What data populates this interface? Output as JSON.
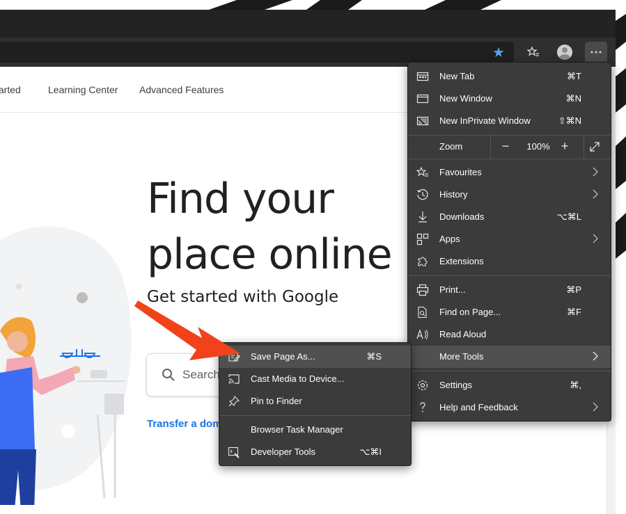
{
  "nav": {
    "links": [
      "tarted",
      "Learning Center",
      "Advanced Features"
    ]
  },
  "hero": {
    "title_line1": "Find your",
    "title_line2": "place online",
    "subtitle": "Get started with Google"
  },
  "search": {
    "placeholder": "Search"
  },
  "transfer_link": "Transfer a dom",
  "toolbar": {
    "icons": [
      "star-icon",
      "favorites-icon",
      "profile-avatar",
      "more-icon"
    ],
    "accent": "#5c9ded"
  },
  "main_menu": {
    "items": [
      {
        "label": "New Tab",
        "shortcut": "⌘T",
        "icon": "new-tab-icon"
      },
      {
        "label": "New Window",
        "shortcut": "⌘N",
        "icon": "new-window-icon"
      },
      {
        "label": "New InPrivate Window",
        "shortcut": "⇧⌘N",
        "icon": "inprivate-icon"
      },
      {
        "label": "Favourites",
        "shortcut": "",
        "icon": "favourites-icon"
      },
      {
        "label": "History",
        "shortcut": "",
        "icon": "history-icon"
      },
      {
        "label": "Downloads",
        "shortcut": "⌥⌘L",
        "icon": "downloads-icon"
      },
      {
        "label": "Apps",
        "shortcut": "",
        "icon": "apps-icon"
      },
      {
        "label": "Extensions",
        "shortcut": "",
        "icon": "extensions-icon"
      },
      {
        "label": "Print...",
        "shortcut": "⌘P",
        "icon": "print-icon"
      },
      {
        "label": "Find on Page...",
        "shortcut": "⌘F",
        "icon": "find-icon"
      },
      {
        "label": "Read Aloud",
        "shortcut": "",
        "icon": "read-aloud-icon"
      },
      {
        "label": "More Tools",
        "shortcut": "",
        "icon": ""
      },
      {
        "label": "Settings",
        "shortcut": "⌘,",
        "icon": "settings-icon"
      },
      {
        "label": "Help and Feedback",
        "shortcut": "",
        "icon": "help-icon"
      }
    ],
    "zoom": {
      "label": "Zoom",
      "value": "100%",
      "minus": "−",
      "plus": "+"
    }
  },
  "sub_menu": {
    "items": [
      {
        "label": "Save Page As...",
        "shortcut": "⌘S",
        "icon": "save-page-icon"
      },
      {
        "label": "Cast Media to Device...",
        "shortcut": "",
        "icon": "cast-icon"
      },
      {
        "label": "Pin to Finder",
        "shortcut": "",
        "icon": "pin-icon"
      },
      {
        "label": "Browser Task Manager",
        "shortcut": "",
        "icon": ""
      },
      {
        "label": "Developer Tools",
        "shortcut": "⌥⌘I",
        "icon": "developer-tools-icon"
      }
    ]
  },
  "annotation": {
    "arrow_color": "#f2421b"
  }
}
